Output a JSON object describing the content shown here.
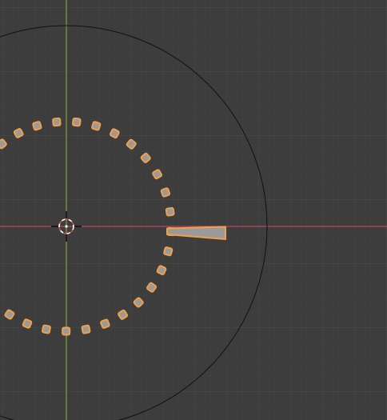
{
  "viewport": {
    "view": "3d-viewport-top-orthographic",
    "theme": {
      "background": "#3d3d3d",
      "grid_minor": "#444444",
      "grid_major": "#4c4c4c",
      "axis_x": "#b84a57",
      "axis_y": "#7ea33a",
      "outline_circle": "#111111",
      "selection": "#f0a04a",
      "object_fill": "#9a9a9a",
      "cursor": "#ffffff"
    },
    "objects": [
      {
        "name": "boundary-circle",
        "kind": "circle",
        "selected": false
      },
      {
        "name": "dotted-ring",
        "kind": "array-of-cubes",
        "count": 33,
        "selected": true
      },
      {
        "name": "radial-bar",
        "kind": "cube",
        "selected": true
      }
    ],
    "cursor": {
      "icon": "3d-cursor-icon"
    }
  }
}
